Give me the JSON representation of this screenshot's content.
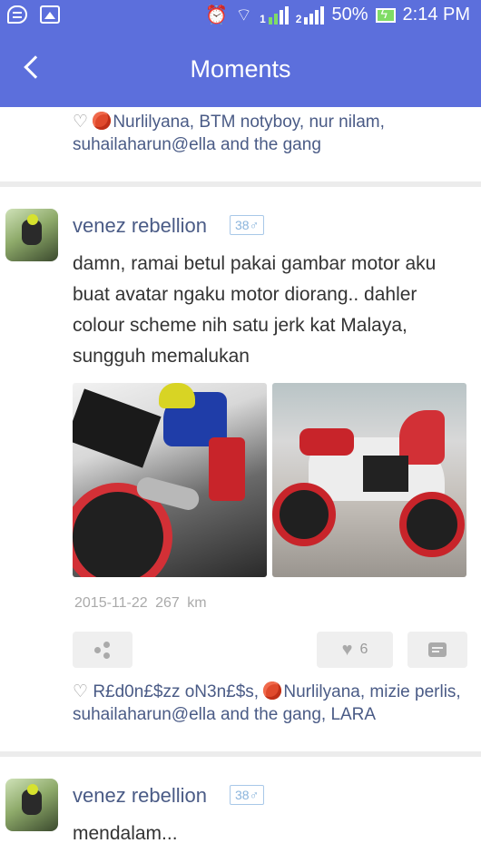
{
  "status_bar": {
    "battery_percent": "50%",
    "time": "2:14 PM",
    "sim1_label": "1",
    "sim2_label": "2"
  },
  "header": {
    "title": "Moments"
  },
  "top_likes": {
    "text": "Nurlilyana, BTM notyboy, nur nilam, suhailaharun@ella and the gang"
  },
  "posts": [
    {
      "username": "venez rebellion",
      "badge": "38♂",
      "text": "damn, ramai betul pakai gambar motor aku buat avatar ngaku motor diorang.. dahler colour scheme nih satu jerk kat Malaya, sungguh memalukan",
      "date": "2015-11-22",
      "distance": "267 km",
      "like_count": "6",
      "likes_prefix": "R£d0n£$zz oN3n£$s,",
      "likes_suffix": "Nurlilyana, mizie perlis, suhailaharun@ella and the gang, LARA"
    },
    {
      "username": "venez rebellion",
      "badge": "38♂",
      "text": "mendalam..."
    }
  ],
  "colors": {
    "header": "#5c6fdc",
    "name": "#4a5b86",
    "bike_red": "#c8242a"
  },
  "icons": [
    "back-arrow-icon",
    "share-icon",
    "heart-icon",
    "comment-icon",
    "rose-icon",
    "heart-outline-icon"
  ]
}
